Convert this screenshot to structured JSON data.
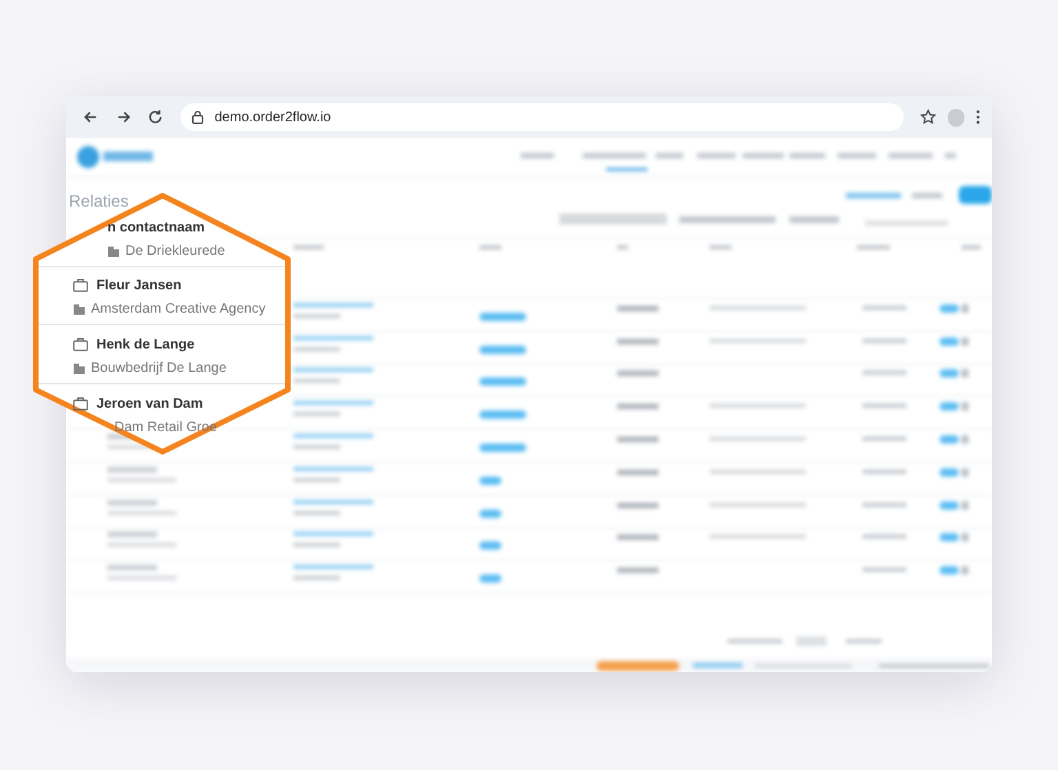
{
  "browser": {
    "url": "demo.order2flow.io"
  },
  "app": {
    "page_title": "Relaties"
  },
  "magnifier": {
    "rows": [
      {
        "name": "n contactnaam",
        "company": "De Driekleurede",
        "name_icon": false,
        "company_icon": true
      },
      {
        "name": "Fleur Jansen",
        "company": "Amsterdam Creative Agency",
        "name_icon": true,
        "company_icon": true
      },
      {
        "name": "Henk de Lange",
        "company": "Bouwbedrijf De Lange",
        "name_icon": true,
        "company_icon": true
      },
      {
        "name": "Jeroen van Dam",
        "company": "Dam Retail Groe",
        "name_icon": true,
        "company_icon": false
      }
    ]
  }
}
